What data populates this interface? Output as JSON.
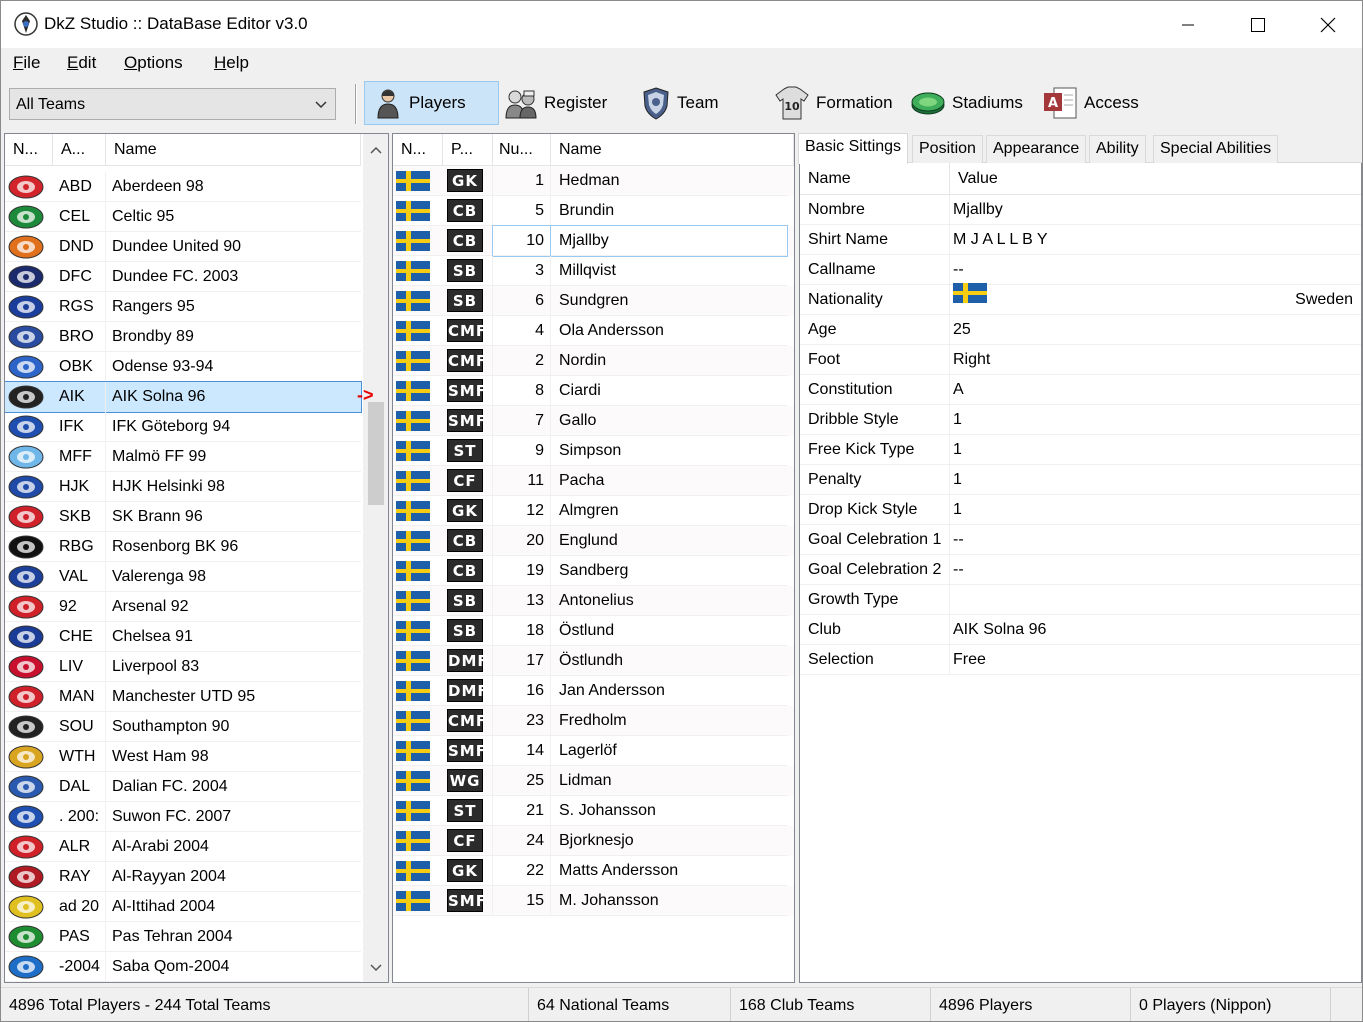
{
  "window": {
    "title": "DkZ Studio :: DataBase Editor v3.0"
  },
  "menu": [
    {
      "accel": "F",
      "rest": "ile"
    },
    {
      "accel": "E",
      "rest": "dit"
    },
    {
      "accel": "O",
      "rest": "ptions"
    },
    {
      "accel": "H",
      "rest": "elp"
    }
  ],
  "toolbar": {
    "team_filter": "All Teams",
    "players": "Players",
    "register": "Register",
    "team": "Team",
    "formation": "Formation",
    "stadiums": "Stadiums",
    "access": "Access"
  },
  "teams": {
    "headers": [
      "N...",
      "A...",
      "Name"
    ],
    "selected_index": 7,
    "rows": [
      {
        "abbr": "ABD",
        "name": "Aberdeen 98",
        "color": "#d4242b"
      },
      {
        "abbr": "CEL",
        "name": "Celtic 95",
        "color": "#1c8a3a"
      },
      {
        "abbr": "DND",
        "name": "Dundee United 90",
        "color": "#e0701c"
      },
      {
        "abbr": "DFC",
        "name": "Dundee FC. 2003",
        "color": "#1a2a6c"
      },
      {
        "abbr": "RGS",
        "name": "Rangers 95",
        "color": "#1b3e9c"
      },
      {
        "abbr": "BRO",
        "name": "Brondby 89",
        "color": "#2a4ca0"
      },
      {
        "abbr": "OBK",
        "name": "Odense 93-94",
        "color": "#2c64c8"
      },
      {
        "abbr": "AIK",
        "name": "AIK Solna 96",
        "color": "#222222"
      },
      {
        "abbr": "IFK",
        "name": "IFK Göteborg 94",
        "color": "#1e4fb0"
      },
      {
        "abbr": "MFF",
        "name": "Malmö FF 99",
        "color": "#6fb7e8"
      },
      {
        "abbr": "HJK",
        "name": "HJK Helsinki 98",
        "color": "#1f4aa8"
      },
      {
        "abbr": "SKB",
        "name": "SK Brann 96",
        "color": "#d0202a"
      },
      {
        "abbr": "RBG",
        "name": "Rosenborg BK 96",
        "color": "#111111"
      },
      {
        "abbr": "VAL",
        "name": "Valerenga 98",
        "color": "#1c3f9a"
      },
      {
        "abbr": "92",
        "name": "Arsenal 92",
        "color": "#d02028"
      },
      {
        "abbr": "CHE",
        "name": "Chelsea 91",
        "color": "#1a3c96"
      },
      {
        "abbr": "LIV",
        "name": "Liverpool 83",
        "color": "#c8102e"
      },
      {
        "abbr": "MAN",
        "name": "Manchester UTD 95",
        "color": "#d0202a"
      },
      {
        "abbr": "SOU",
        "name": "Southampton 90",
        "color": "#222222"
      },
      {
        "abbr": "WTH",
        "name": "West Ham 98",
        "color": "#d9a520"
      },
      {
        "abbr": "DAL",
        "name": "Dalian FC. 2004",
        "color": "#2a5ab0"
      },
      {
        "abbr": ". 200:",
        "name": "Suwon FC. 2007",
        "color": "#1f4fb0"
      },
      {
        "abbr": "ALR",
        "name": "Al-Arabi 2004",
        "color": "#d02028"
      },
      {
        "abbr": "RAY",
        "name": "Al-Rayyan 2004",
        "color": "#b01a22"
      },
      {
        "abbr": "ad 20",
        "name": "Al-Ittihad 2004",
        "color": "#e0c020"
      },
      {
        "abbr": "PAS",
        "name": "Pas Tehran 2004",
        "color": "#1e8c30"
      },
      {
        "abbr": "-2004",
        "name": "Saba Qom-2004",
        "color": "#1e6ec8"
      }
    ]
  },
  "players": {
    "headers": [
      "N...",
      "P...",
      "Nu...",
      "Name"
    ],
    "selected_index": 2,
    "rows": [
      {
        "pos": "GK",
        "num": "1",
        "name": "Hedman"
      },
      {
        "pos": "CB",
        "num": "5",
        "name": "Brundin"
      },
      {
        "pos": "CB",
        "num": "10",
        "name": "Mjallby"
      },
      {
        "pos": "SB",
        "num": "3",
        "name": "Millqvist"
      },
      {
        "pos": "SB",
        "num": "6",
        "name": "Sundgren"
      },
      {
        "pos": "CMF",
        "num": "4",
        "name": "Ola Andersson"
      },
      {
        "pos": "CMF",
        "num": "2",
        "name": "Nordin"
      },
      {
        "pos": "SMF",
        "num": "8",
        "name": "Ciardi"
      },
      {
        "pos": "SMF",
        "num": "7",
        "name": "Gallo"
      },
      {
        "pos": "ST",
        "num": "9",
        "name": "Simpson"
      },
      {
        "pos": "CF",
        "num": "11",
        "name": "Pacha"
      },
      {
        "pos": "GK",
        "num": "12",
        "name": "Almgren"
      },
      {
        "pos": "CB",
        "num": "20",
        "name": "Englund"
      },
      {
        "pos": "CB",
        "num": "19",
        "name": "Sandberg"
      },
      {
        "pos": "SB",
        "num": "13",
        "name": "Antonelius"
      },
      {
        "pos": "SB",
        "num": "18",
        "name": "Östlund"
      },
      {
        "pos": "DMF",
        "num": "17",
        "name": "Östlundh"
      },
      {
        "pos": "DMF",
        "num": "16",
        "name": "Jan Andersson"
      },
      {
        "pos": "CMF",
        "num": "23",
        "name": "Fredholm"
      },
      {
        "pos": "SMF",
        "num": "14",
        "name": "Lagerlöf"
      },
      {
        "pos": "WG",
        "num": "25",
        "name": "Lidman"
      },
      {
        "pos": "ST",
        "num": "21",
        "name": "S. Johansson"
      },
      {
        "pos": "CF",
        "num": "24",
        "name": "Bjorknesjo"
      },
      {
        "pos": "GK",
        "num": "22",
        "name": "Matts Andersson"
      },
      {
        "pos": "SMF",
        "num": "15",
        "name": "M. Johansson"
      }
    ]
  },
  "tabs": [
    "Basic Sittings",
    "Position",
    "Appearance",
    "Ability",
    "Special Abilities"
  ],
  "properties": {
    "header_name": "Name",
    "header_value": "Value",
    "rows": [
      {
        "key": "Nombre",
        "value": "Mjallby"
      },
      {
        "key": "Shirt Name",
        "value": "M J A L L B Y"
      },
      {
        "key": "Callname",
        "value": "--"
      },
      {
        "key": "Nationality",
        "value": "",
        "flag": true,
        "right": "Sweden"
      },
      {
        "key": "Age",
        "value": "25"
      },
      {
        "key": "Foot",
        "value": "Right"
      },
      {
        "key": "Constitution",
        "value": "A"
      },
      {
        "key": "Dribble Style",
        "value": "1"
      },
      {
        "key": "Free Kick Type",
        "value": "1"
      },
      {
        "key": "Penalty",
        "value": "1"
      },
      {
        "key": "Drop Kick Style",
        "value": "1"
      },
      {
        "key": "Goal Celebration 1",
        "value": "--"
      },
      {
        "key": "Goal Celebration 2",
        "value": "--"
      },
      {
        "key": "Growth Type",
        "value": ""
      },
      {
        "key": "Club",
        "value": "AIK Solna 96"
      },
      {
        "key": "Selection",
        "value": "Free"
      }
    ]
  },
  "status": {
    "totals": "4896 Total Players  -  244 Total Teams",
    "national": "64 National Teams",
    "club": "168 Club Teams",
    "players": "4896 Players",
    "nippon": "0 Players (Nippon)"
  },
  "colors": {
    "selection": "#cce8ff",
    "flag_blue": "#1d5fa8",
    "flag_yellow": "#f7cd14",
    "arrow_red": "#e60000"
  }
}
